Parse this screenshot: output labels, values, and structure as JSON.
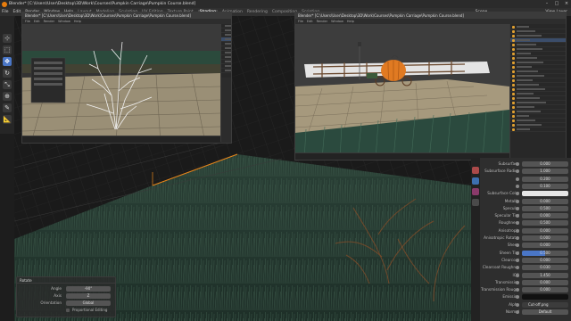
{
  "titlebar": {
    "title": "Blender* [C:\\Users\\User\\Desktop\\3D\\Work\\Courses\\Pumpkin Carriage\\Pumpkin Course.blend]"
  },
  "menu": {
    "items": [
      "File",
      "Edit",
      "Render",
      "Window",
      "Help"
    ],
    "workspaces": [
      "Layout",
      "Modeling",
      "Sculpting",
      "UV Editing",
      "Texture Paint",
      "Shading",
      "Animation",
      "Rendering",
      "Compositing",
      "Scripting"
    ],
    "active_workspace": "Shading"
  },
  "scene": {
    "scene_label": "Scene",
    "view_layer_label": "View Layer"
  },
  "tools": [
    {
      "icon": "cursor-icon",
      "glyph": "⊹",
      "active": false
    },
    {
      "icon": "select-box-icon",
      "glyph": "⬚",
      "active": false
    },
    {
      "icon": "move-icon",
      "glyph": "✥",
      "active": true
    },
    {
      "icon": "rotate-icon",
      "glyph": "↻",
      "active": false
    },
    {
      "icon": "scale-icon",
      "glyph": "⤡",
      "active": false
    },
    {
      "icon": "transform-icon",
      "glyph": "⊕",
      "active": false
    },
    {
      "icon": "annotate-icon",
      "glyph": "✎",
      "active": false
    },
    {
      "icon": "measure-icon",
      "glyph": "📐",
      "active": false
    }
  ],
  "windows": {
    "left": {
      "title": "Blender* [C:\\Users\\User\\Desktop\\3D\\Work\\Courses\\Pumpkin Carriage\\Pumpkin Course.blend]",
      "menu": [
        "File",
        "Edit",
        "Render",
        "Window",
        "Help"
      ]
    },
    "right": {
      "title": "Blender* [C:\\Users\\User\\Desktop\\3D\\Work\\Courses\\Pumpkin Carriage\\Pumpkin Course.blend]",
      "menu": [
        "File",
        "Edit",
        "Render",
        "Window",
        "Help"
      ]
    }
  },
  "properties": {
    "rows": [
      {
        "label": "Subsurface",
        "value": "0.000"
      },
      {
        "label": "Subsurface Radius",
        "value": "1.000"
      },
      {
        "label": "",
        "value": "0.200"
      },
      {
        "label": "",
        "value": "0.100"
      },
      {
        "label": "Subsurface Color",
        "value": "",
        "swatch": true
      },
      {
        "label": "Metallic",
        "value": "0.000"
      },
      {
        "label": "Specular",
        "value": "0.500"
      },
      {
        "label": "Specular Tint",
        "value": "0.000"
      },
      {
        "label": "Roughness",
        "value": "0.500"
      },
      {
        "label": "Anisotropic",
        "value": "0.000"
      },
      {
        "label": "Anisotropic Rotat...",
        "value": "0.000"
      },
      {
        "label": "Sheen",
        "value": "0.000"
      },
      {
        "label": "Sheen Tint",
        "value": "0.500",
        "fill": 0.5
      },
      {
        "label": "Clearcoat",
        "value": "0.000"
      },
      {
        "label": "Clearcoat Roughn...",
        "value": "0.030"
      },
      {
        "label": "IOR",
        "value": "1.450"
      },
      {
        "label": "Transmission",
        "value": "0.000"
      },
      {
        "label": "Transmission Roug...",
        "value": "0.000"
      },
      {
        "label": "Emission",
        "value": "",
        "swatch_dark": true
      },
      {
        "label": "Alpha",
        "value": "Cut-off.png",
        "image": true
      },
      {
        "label": "Normal",
        "value": "Default"
      }
    ]
  },
  "operator": {
    "title": "Rotate",
    "angle_label": "Angle",
    "angle_value": "-90°",
    "axis_label": "Axis",
    "axis_value": "Z",
    "orientation_label": "Orientation",
    "orientation_value": "Global",
    "proportional_label": "Proportional Editing"
  },
  "colors": {
    "accent": "#4a76c6",
    "orange": "#e87d0d",
    "grass": "#2f4a3e",
    "pumpkin": "#e07a22"
  }
}
